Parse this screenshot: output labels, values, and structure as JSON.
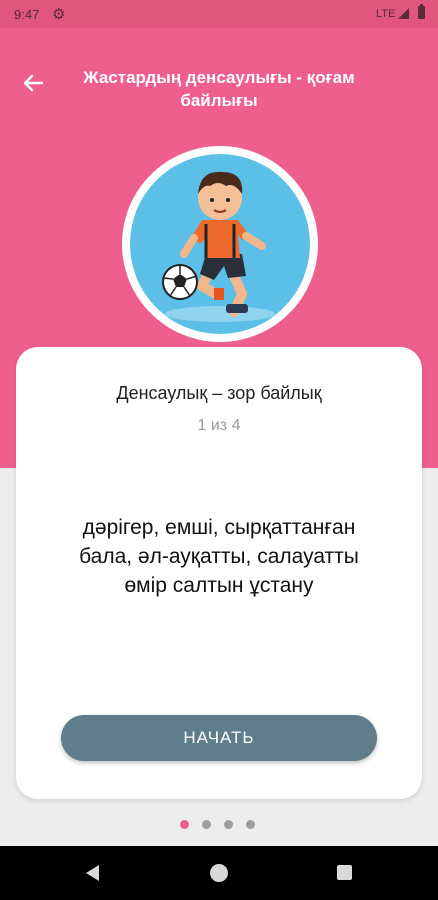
{
  "status_bar": {
    "time": "9:47",
    "network": "LTE",
    "icons": [
      "gear-icon",
      "signal-icon",
      "battery-icon"
    ]
  },
  "header": {
    "back_icon": "arrow-left-icon",
    "title": "Жастардың денсаулығы - қоғам байлығы",
    "background_color": "#ef5f8d"
  },
  "illustration": {
    "description_icon": "boy-playing-football-illustration"
  },
  "card": {
    "title": "Денсаулық – зор байлық",
    "progress": "1 из 4",
    "body": "дәрігер, емші, сырқаттанған бала, әл-ауқатты, салауатты өмір салтын ұстану",
    "start_button": "НАЧАТЬ",
    "button_color": "#607d8b"
  },
  "pager": {
    "total": 4,
    "active_index": 0,
    "active_color": "#ef5f8d"
  },
  "nav_bar": {
    "icons": [
      "nav-back-icon",
      "nav-home-icon",
      "nav-recent-icon"
    ]
  }
}
